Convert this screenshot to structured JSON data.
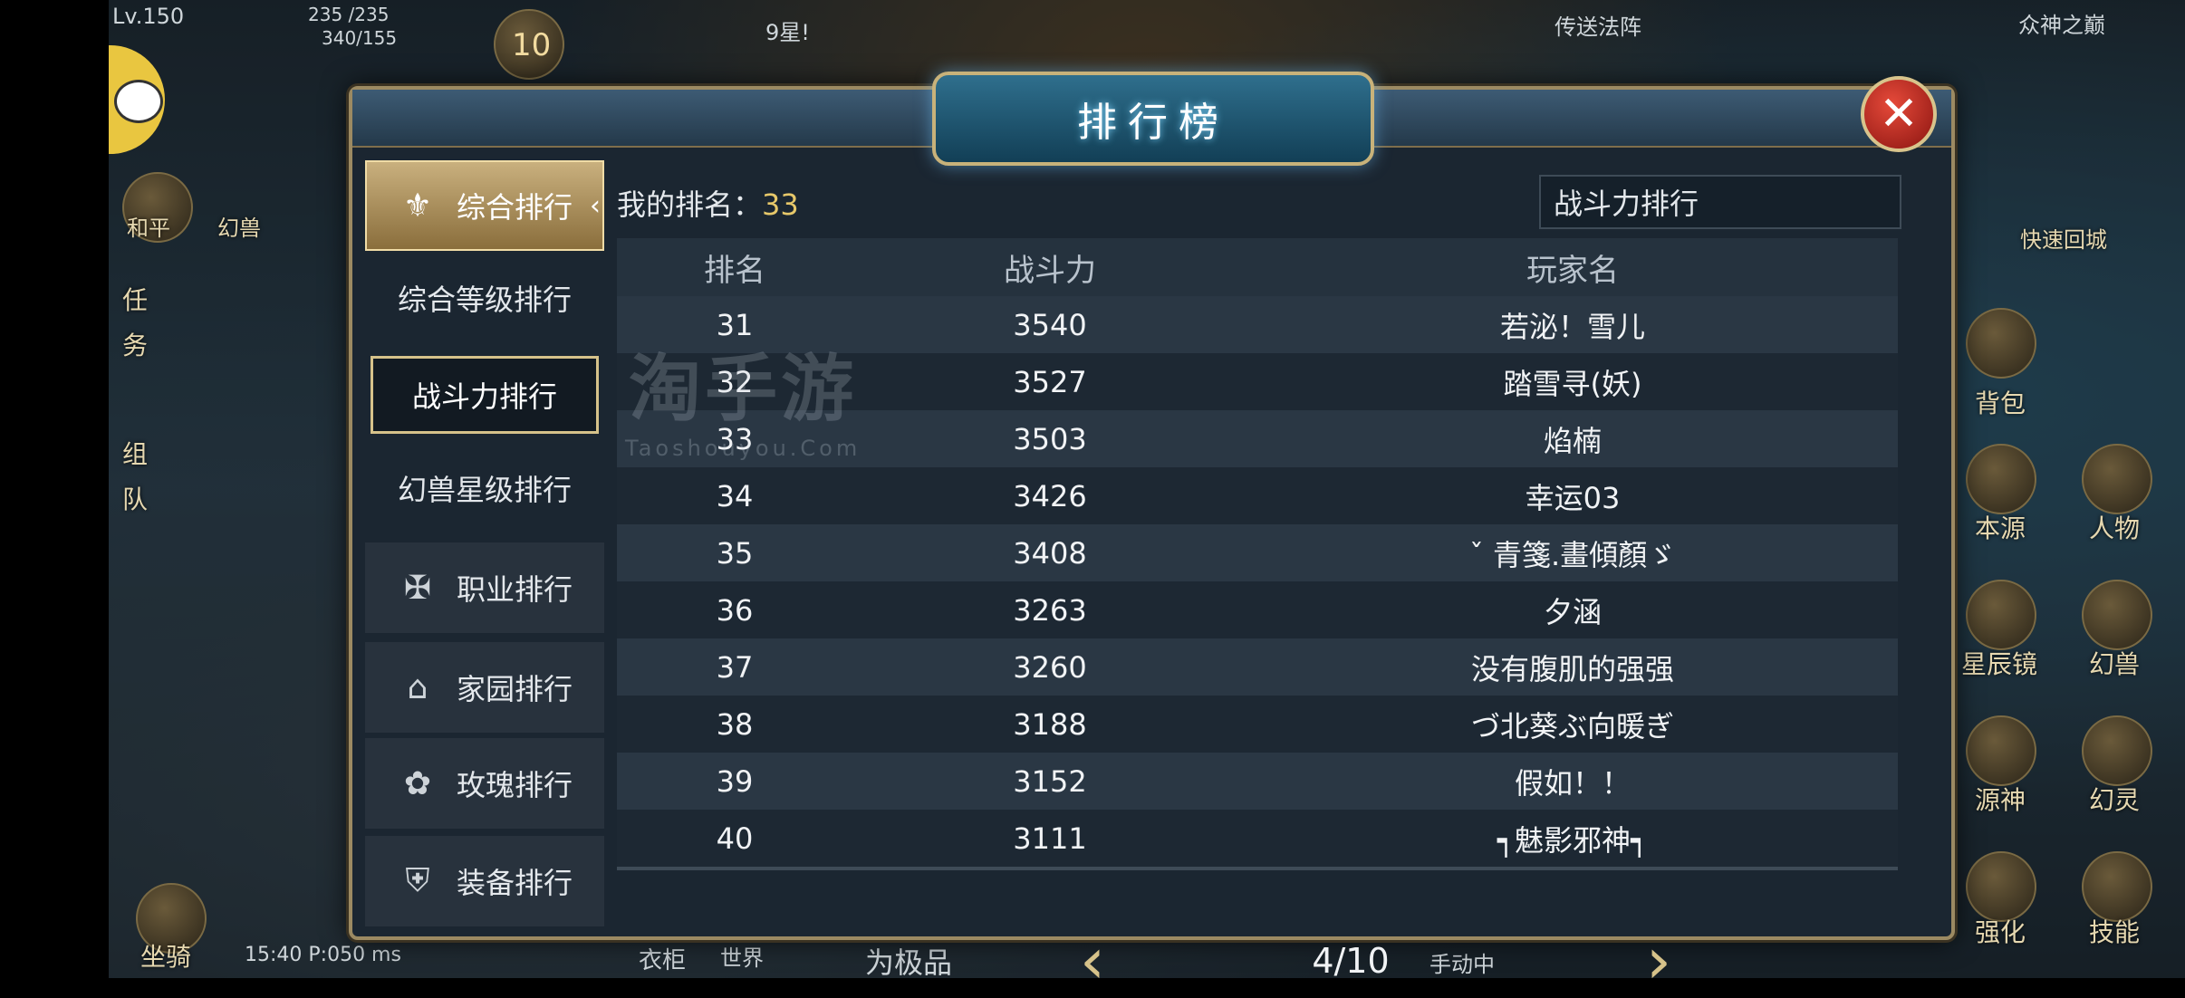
{
  "hud": {
    "level": "Lv.150",
    "hp": "235 /235",
    "mp": "340/155",
    "star_notice": "9星!",
    "portal": "传送法阵",
    "zone": "众神之巅",
    "level_badge": "10",
    "left_tabs": [
      "任",
      "务",
      "组",
      "队"
    ],
    "quick_return": "快速回城",
    "right_buttons": [
      "背包",
      "本源",
      "人物",
      "星辰镜",
      "幻兽",
      "源神",
      "幻灵",
      "强化",
      "技能"
    ],
    "bottom_left": "坐骑",
    "time_status": "15:40 P:050 ms",
    "bottom_chat": [
      "衣柜",
      "世界"
    ],
    "bottom_notice": "为极品",
    "auto_mode": "手动中",
    "peace": "和平",
    "huanshou": "幻兽"
  },
  "panel": {
    "title": "排行榜",
    "close_label": "✕",
    "sidebar": [
      {
        "label": "综合排行",
        "icon": "crown-wings-icon",
        "type": "main-active"
      },
      {
        "label": "综合等级排行",
        "type": "sub"
      },
      {
        "label": "战斗力排行",
        "type": "sub-active"
      },
      {
        "label": "幻兽星级排行",
        "type": "sub"
      },
      {
        "label": "职业排行",
        "icon": "class-emblem-icon",
        "type": "main"
      },
      {
        "label": "家园排行",
        "icon": "home-icon",
        "type": "main"
      },
      {
        "label": "玫瑰排行",
        "icon": "rose-icon",
        "type": "main"
      },
      {
        "label": "装备排行",
        "icon": "shield-icon",
        "type": "main"
      }
    ],
    "my_rank_label": "我的排名：",
    "my_rank_value": "33",
    "filter_value": "战斗力排行",
    "columns": [
      "排名",
      "战斗力",
      "玩家名"
    ],
    "rows": [
      {
        "rank": "31",
        "power": "3540",
        "name": "若泌！雪儿"
      },
      {
        "rank": "32",
        "power": "3527",
        "name": "踏雪寻(妖)"
      },
      {
        "rank": "33",
        "power": "3503",
        "name": "焰楠"
      },
      {
        "rank": "34",
        "power": "3426",
        "name": "幸运03"
      },
      {
        "rank": "35",
        "power": "3408",
        "name": "ˇ 青箋.畫傾顏ゞ"
      },
      {
        "rank": "36",
        "power": "3263",
        "name": "夕涵"
      },
      {
        "rank": "37",
        "power": "3260",
        "name": "没有腹肌的强强"
      },
      {
        "rank": "38",
        "power": "3188",
        "name": "づ北葵ぶ向暖ぎ"
      },
      {
        "rank": "39",
        "power": "3152",
        "name": "假如！！"
      },
      {
        "rank": "40",
        "power": "3111",
        "name": "┑魅影邪神┑"
      }
    ],
    "page_indicator": "4/10",
    "prev_label": "‹",
    "next_label": "›"
  },
  "watermark": {
    "main": "淘手游",
    "sub": "Taoshouyou.Com"
  }
}
